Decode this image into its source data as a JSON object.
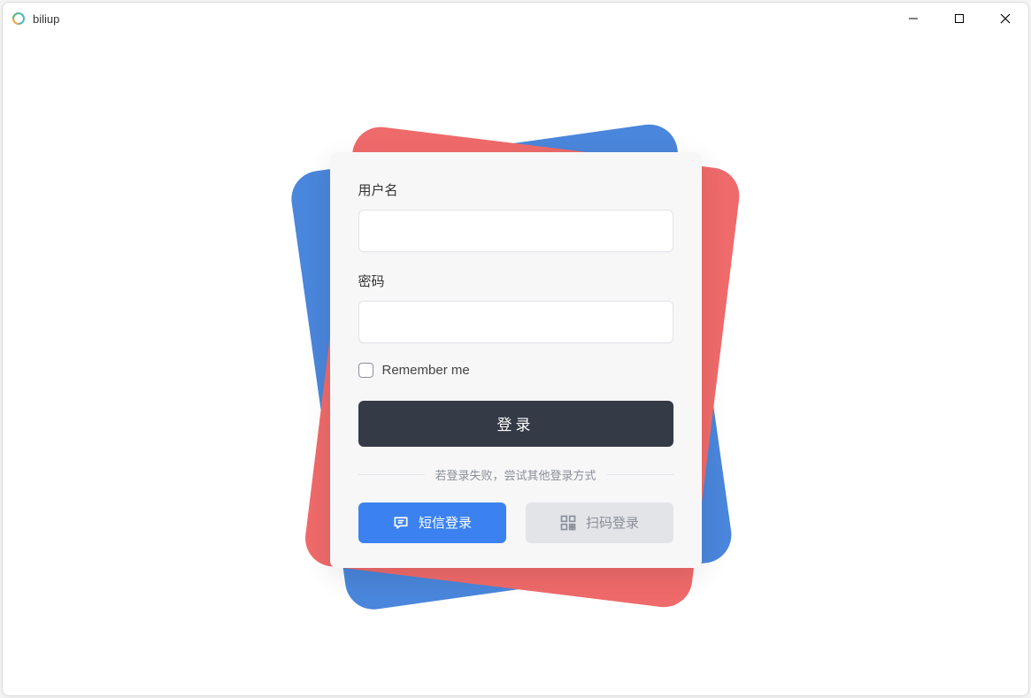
{
  "window": {
    "title": "biliup"
  },
  "form": {
    "username_label": "用户名",
    "username_value": "",
    "password_label": "密码",
    "password_value": "",
    "remember_label": "Remember me",
    "remember_checked": false,
    "login_button": "登录",
    "divider_text": "若登录失败，尝试其他登录方式",
    "sms_login_label": "短信登录",
    "qr_login_label": "扫码登录"
  },
  "colors": {
    "card_red": "#ef6a6a",
    "card_blue": "#4a86db",
    "primary_button": "#343a46",
    "sms_button": "#3b82f0",
    "qr_button": "#e2e4e8"
  }
}
